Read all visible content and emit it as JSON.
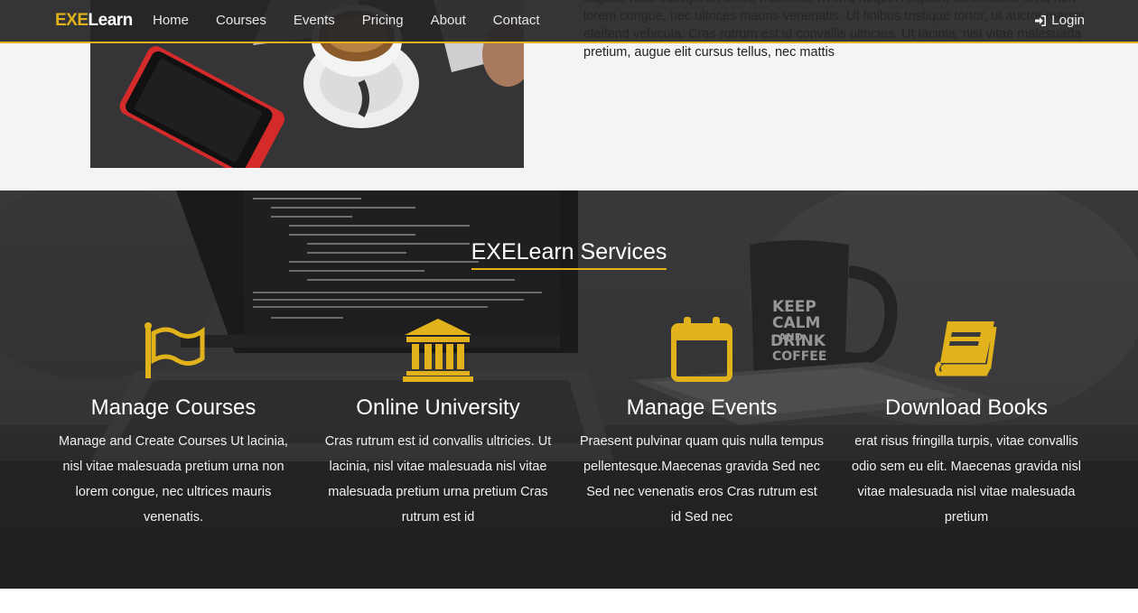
{
  "brand": {
    "accent": "EXE",
    "rest": "Learn"
  },
  "nav": {
    "links": [
      "Home",
      "Courses",
      "Events",
      "Pricing",
      "About",
      "Contact"
    ],
    "login_label": "Login"
  },
  "about": {
    "text": "sagittis vitae suscipit sit amet, maximus viverra neque. Aliquam consectetur urna non lorem congue, nec ultrices mauris venenatis. Ut finibus tristique tortor, ut auctor mauris eleifend vehicula. Cras rutrum est id convallis ultricies. Ut lacinia, nisl vitae malesuada pretium, augue elit cursus tellus, nec mattis"
  },
  "services": {
    "title": "EXELearn Services",
    "items": [
      {
        "icon": "flag-icon",
        "title": "Manage Courses",
        "text": "Manage and Create Courses Ut lacinia, nisl vitae malesuada pretium urna non lorem congue, nec ultrices mauris venenatis."
      },
      {
        "icon": "university-icon",
        "title": "Online University",
        "text": "Cras rutrum est id convallis ultricies. Ut lacinia, nisl vitae malesuada nisl vitae malesuada pretium urna pretium Cras rutrum est id"
      },
      {
        "icon": "calendar-icon",
        "title": "Manage Events",
        "text": "Praesent pulvinar quam quis nulla tempus pellentesque.Maecenas gravida Sed nec Sed nec venenatis eros Cras rutrum est id Sed nec"
      },
      {
        "icon": "book-icon",
        "title": "Download Books",
        "text": "erat risus fringilla turpis, vitae convallis odio sem eu elit. Maecenas gravida nisl vitae malesuada nisl vitae malesuada pretium"
      }
    ]
  },
  "colors": {
    "accent": "#e1b219",
    "navbar": "#262628",
    "section_bg": "#f4f4f4"
  }
}
